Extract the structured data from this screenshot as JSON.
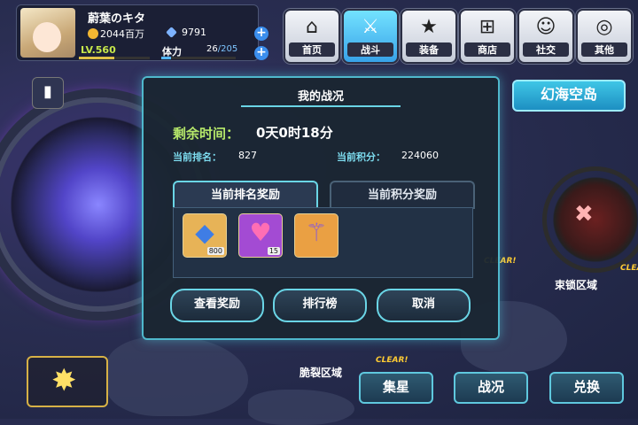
{
  "player": {
    "name": "蔚葉のキタ",
    "gold": "2044百万",
    "gems": "9791",
    "level": "LV.560",
    "xp_fraction": 0.5,
    "stamina_label": "体力",
    "stamina_current": "26",
    "stamina_max": "/205",
    "stamina_fraction": 0.13
  },
  "nav": {
    "home": "首页",
    "battle": "战斗",
    "equip": "装备",
    "shop": "商店",
    "social": "社交",
    "other": "其他",
    "active": "battle"
  },
  "map": {
    "zone_title": "幻海空岛",
    "chain_zone": "束锁区域",
    "fragile_zone": "脆裂区域",
    "clear_label": "CLEAR!"
  },
  "modal": {
    "title": "我的战况",
    "time_label": "剩余时间：",
    "time_value": "0天0时18分",
    "rank_label": "当前排名：",
    "rank_value": "827",
    "score_label": "当前积分：",
    "score_value": "224060",
    "tabs": [
      "当前排名奖励",
      "当前积分奖励"
    ],
    "active_tab": 0,
    "rewards": [
      {
        "icon": "blue-crystal-icon",
        "qty": "800"
      },
      {
        "icon": "rainbow-heart-crystal-icon",
        "qty": "15"
      },
      {
        "icon": "violet-staff-icon",
        "qty": ""
      }
    ],
    "buttons": {
      "view_reward": "查看奖励",
      "leaderboard": "排行榜",
      "cancel": "取消"
    }
  },
  "bottom": {
    "collect": "集星",
    "status": "战况",
    "exchange": "兑换"
  },
  "colors": {
    "accent": "#6ad5e6",
    "time_label": "#b6e86a",
    "stat_label": "#7ddcef"
  }
}
